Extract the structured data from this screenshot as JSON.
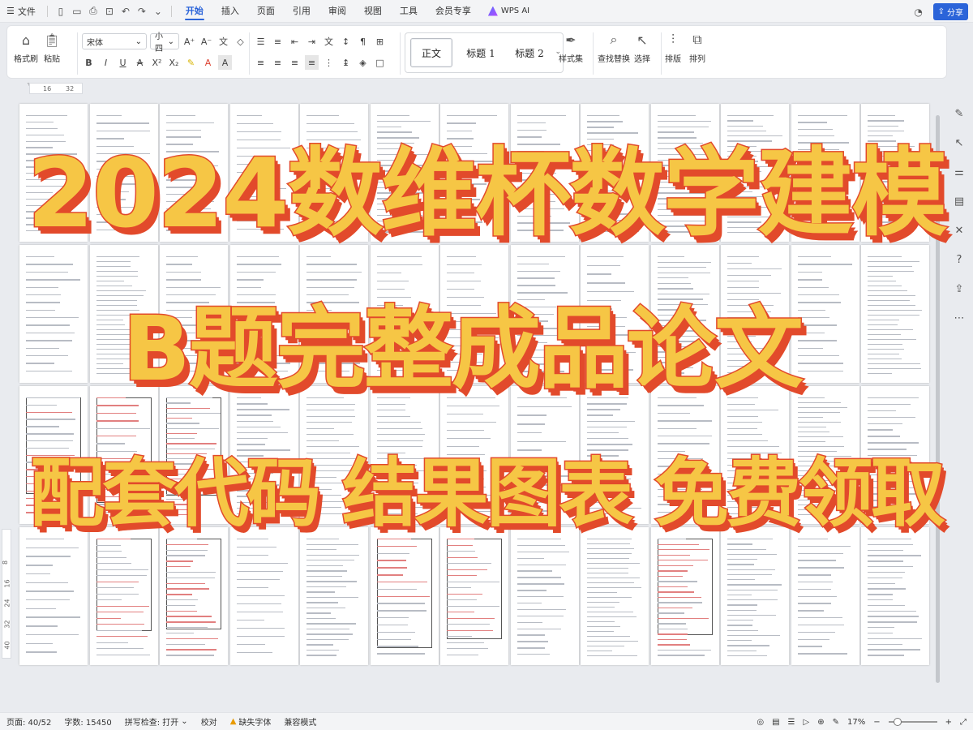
{
  "menubar": {
    "file_label": "文件",
    "tabs": [
      "开始",
      "插入",
      "页面",
      "引用",
      "审阅",
      "视图",
      "工具",
      "会员专享"
    ],
    "active_tab": "开始",
    "wps_ai_label": "WPS AI",
    "share_label": "分享"
  },
  "ribbon": {
    "format_painter": "格式刷",
    "paste": "粘贴",
    "font_name": "宋体",
    "font_size": "小四",
    "styles": [
      "正文",
      "标题 1",
      "标题 2"
    ],
    "style_set": "样式集",
    "find_replace": "查找替换",
    "select": "选择",
    "layout": "排版",
    "arrange": "排列"
  },
  "ruler": {
    "marks": [
      "16",
      "32"
    ]
  },
  "vruler": {
    "marks": [
      "8",
      "16",
      "24",
      "32",
      "40"
    ]
  },
  "overlay": {
    "line1": "2024数维杯数学建模",
    "line2": "B题完整成品论文",
    "line3": "配套代码 结果图表 免费领取"
  },
  "statusbar": {
    "page": "页面: 40/52",
    "words": "字数: 15450",
    "spell": "拼写检查: 打开",
    "proof": "校对",
    "missing_font": "缺失字体",
    "compat": "兼容模式",
    "zoom": "17%"
  },
  "colors": {
    "accent": "#2b64d9",
    "overlay_fill": "#f6c645",
    "overlay_stroke": "#e24a2b"
  }
}
